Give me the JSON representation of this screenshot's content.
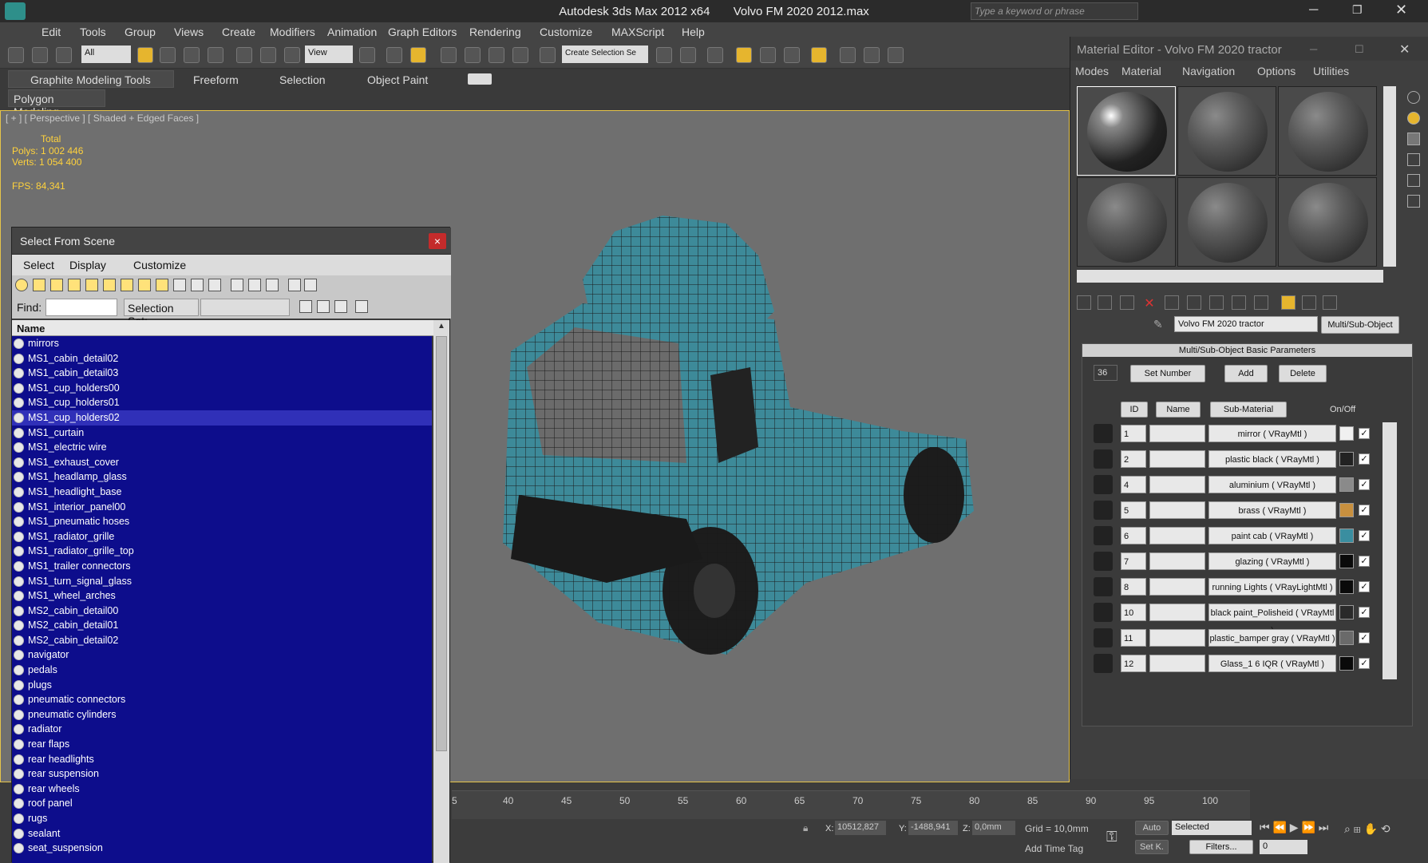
{
  "app": {
    "title": "Autodesk 3ds Max 2012 x64",
    "file": "Volvo FM 2020 2012.max",
    "search_placeholder": "Type a keyword or phrase"
  },
  "menu": [
    "Edit",
    "Tools",
    "Group",
    "Views",
    "Create",
    "Modifiers",
    "Animation",
    "Graph Editors",
    "Rendering",
    "Customize",
    "MAXScript",
    "Help"
  ],
  "toolbar": {
    "filter": "All",
    "coord": "View",
    "selection_set": "Create Selection Se"
  },
  "ribbon": {
    "tabs": [
      "Graphite Modeling Tools",
      "Freeform",
      "Selection",
      "Object Paint"
    ],
    "sub": "Polygon Modeling"
  },
  "viewport": {
    "label": "[ + ] [ Perspective ] [ Shaded + Edged Faces ]",
    "stats_header": "Total",
    "polys": "Polys:  1 002 446",
    "verts": "Verts:  1 054 400",
    "fps": "FPS:   84,341"
  },
  "sfs": {
    "title": "Select From Scene",
    "close": "×",
    "menu": [
      "Select",
      "Display",
      "Customize"
    ],
    "find_label": "Find:",
    "selset_label": "Selection Set:",
    "col_name": "Name",
    "items": [
      "mirrors",
      "MS1_cabin_detail02",
      "MS1_cabin_detail03",
      "MS1_cup_holders00",
      "MS1_cup_holders01",
      "MS1_cup_holders02",
      "MS1_curtain",
      "MS1_electric wire",
      "MS1_exhaust_cover",
      "MS1_headlamp_glass",
      "MS1_headlight_base",
      "MS1_interior_panel00",
      "MS1_pneumatic hoses",
      "MS1_radiator_grille",
      "MS1_radiator_grille_top",
      "MS1_trailer connectors",
      "MS1_turn_signal_glass",
      "MS1_wheel_arches",
      "MS2_cabin_detail00",
      "MS2_cabin_detail01",
      "MS2_cabin_detail02",
      "navigator",
      "pedals",
      "plugs",
      "pneumatic connectors",
      "pneumatic cylinders",
      "radiator",
      "rear flaps",
      "rear headlights",
      "rear suspension",
      "rear wheels",
      "roof panel",
      "rugs",
      "sealant",
      "seat_suspension"
    ]
  },
  "mated": {
    "title": "Material Editor - Volvo FM 2020 tractor",
    "menu": [
      "Modes",
      "Material",
      "Navigation",
      "Options",
      "Utilities"
    ],
    "material_name": "Volvo FM 2020 tractor",
    "material_type": "Multi/Sub-Object",
    "rollout": "Multi/Sub-Object Basic Parameters",
    "count": "36",
    "set_number": "Set Number",
    "add": "Add",
    "delete": "Delete",
    "col_id": "ID",
    "col_name": "Name",
    "col_sub": "Sub-Material",
    "col_onoff": "On/Off",
    "rows": [
      {
        "id": "1",
        "sub": "mirror  ( VRayMtl )",
        "color": "#f0f0f0"
      },
      {
        "id": "2",
        "sub": "plastic black  ( VRayMtl )",
        "color": "#222222"
      },
      {
        "id": "4",
        "sub": "aluminium  ( VRayMtl )",
        "color": "#8a8a8a"
      },
      {
        "id": "5",
        "sub": "brass  ( VRayMtl )",
        "color": "#c8903f"
      },
      {
        "id": "6",
        "sub": "paint cab  ( VRayMtl )",
        "color": "#3a8ea0"
      },
      {
        "id": "7",
        "sub": "glazing  ( VRayMtl )",
        "color": "#0a0a0a"
      },
      {
        "id": "8",
        "sub": "running Lights  ( VRayLightMtl )",
        "color": "#0a0a0a"
      },
      {
        "id": "10",
        "sub": "black paint_Polisheid  ( VRayMtl )",
        "color": "#2a2a2a"
      },
      {
        "id": "11",
        "sub": "plastic_bamper gray  ( VRayMtl )",
        "color": "#6a6a6a"
      },
      {
        "id": "12",
        "sub": "Glass_1 6 IQR  ( VRayMtl )",
        "color": "#0a0a0a"
      }
    ]
  },
  "timeline": {
    "ticks": [
      "5",
      "40",
      "45",
      "50",
      "55",
      "60",
      "65",
      "70",
      "75",
      "80",
      "85",
      "90",
      "95",
      "100"
    ]
  },
  "status": {
    "x": "10512,827",
    "y": "-1488,941",
    "z": "0,0mm",
    "grid": "Grid = 10,0mm",
    "auto": "Auto",
    "selected": "Selected",
    "setk": "Set K.",
    "filters": "Filters...",
    "add_time_tag": "Add Time Tag",
    "frame": "0"
  }
}
